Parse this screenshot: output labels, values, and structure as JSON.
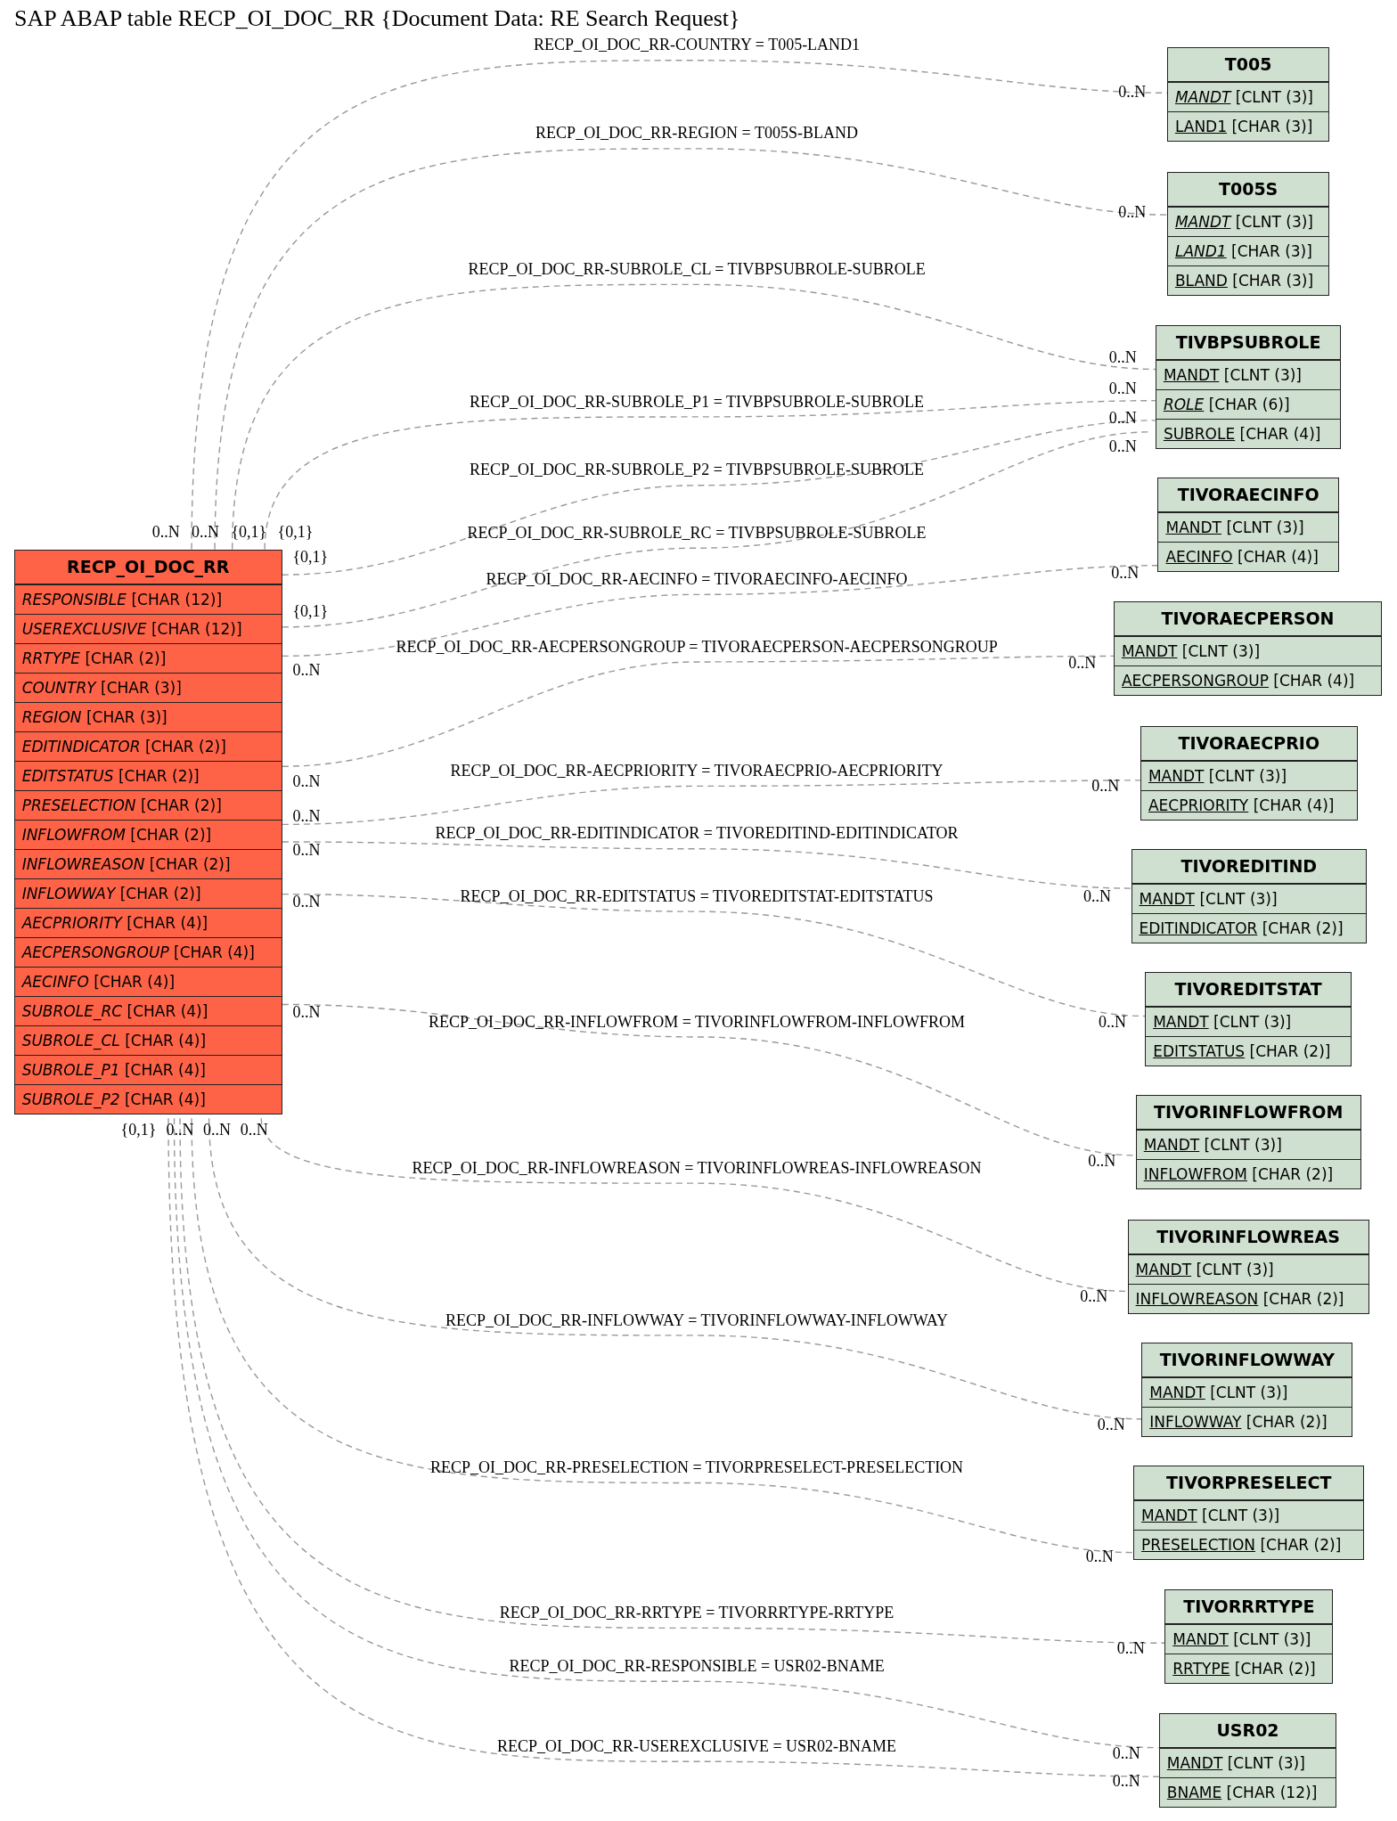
{
  "title": "SAP ABAP table RECP_OI_DOC_RR {Document Data: RE Search Request}",
  "main_table": {
    "name": "RECP_OI_DOC_RR",
    "fields": [
      {
        "name": "RESPONSIBLE",
        "type": "[CHAR (12)]",
        "primary_key": false,
        "foreign_key": true
      },
      {
        "name": "USEREXCLUSIVE",
        "type": "[CHAR (12)]",
        "primary_key": false,
        "foreign_key": true
      },
      {
        "name": "RRTYPE",
        "type": "[CHAR (2)]",
        "primary_key": false,
        "foreign_key": true
      },
      {
        "name": "COUNTRY",
        "type": "[CHAR (3)]",
        "primary_key": false,
        "foreign_key": true
      },
      {
        "name": "REGION",
        "type": "[CHAR (3)]",
        "primary_key": false,
        "foreign_key": true
      },
      {
        "name": "EDITINDICATOR",
        "type": "[CHAR (2)]",
        "primary_key": false,
        "foreign_key": true
      },
      {
        "name": "EDITSTATUS",
        "type": "[CHAR (2)]",
        "primary_key": false,
        "foreign_key": true
      },
      {
        "name": "PRESELECTION",
        "type": "[CHAR (2)]",
        "primary_key": false,
        "foreign_key": true
      },
      {
        "name": "INFLOWFROM",
        "type": "[CHAR (2)]",
        "primary_key": false,
        "foreign_key": true
      },
      {
        "name": "INFLOWREASON",
        "type": "[CHAR (2)]",
        "primary_key": false,
        "foreign_key": true
      },
      {
        "name": "INFLOWWAY",
        "type": "[CHAR (2)]",
        "primary_key": false,
        "foreign_key": true
      },
      {
        "name": "AECPRIORITY",
        "type": "[CHAR (4)]",
        "primary_key": false,
        "foreign_key": true
      },
      {
        "name": "AECPERSONGROUP",
        "type": "[CHAR (4)]",
        "primary_key": false,
        "foreign_key": true
      },
      {
        "name": "AECINFO",
        "type": "[CHAR (4)]",
        "primary_key": false,
        "foreign_key": true
      },
      {
        "name": "SUBROLE_RC",
        "type": "[CHAR (4)]",
        "primary_key": false,
        "foreign_key": true
      },
      {
        "name": "SUBROLE_CL",
        "type": "[CHAR (4)]",
        "primary_key": false,
        "foreign_key": true
      },
      {
        "name": "SUBROLE_P1",
        "type": "[CHAR (4)]",
        "primary_key": false,
        "foreign_key": true
      },
      {
        "name": "SUBROLE_P2",
        "type": "[CHAR (4)]",
        "primary_key": false,
        "foreign_key": true
      }
    ]
  },
  "tables": [
    {
      "name": "T005",
      "fields": [
        {
          "name": "MANDT",
          "type": "[CLNT (3)]",
          "primary_key": true,
          "foreign_key": true
        },
        {
          "name": "LAND1",
          "type": "[CHAR (3)]",
          "primary_key": true,
          "foreign_key": false
        }
      ],
      "relations": [
        {
          "label": "RECP_OI_DOC_RR-COUNTRY = T005-LAND1",
          "source_cardinality": "0..N",
          "target_cardinality": "0..N"
        }
      ]
    },
    {
      "name": "T005S",
      "fields": [
        {
          "name": "MANDT",
          "type": "[CLNT (3)]",
          "primary_key": true,
          "foreign_key": true
        },
        {
          "name": "LAND1",
          "type": "[CHAR (3)]",
          "primary_key": true,
          "foreign_key": true
        },
        {
          "name": "BLAND",
          "type": "[CHAR (3)]",
          "primary_key": true,
          "foreign_key": false
        }
      ],
      "relations": [
        {
          "label": "RECP_OI_DOC_RR-REGION = T005S-BLAND",
          "source_cardinality": "0..N",
          "target_cardinality": "0..N"
        }
      ]
    },
    {
      "name": "TIVBPSUBROLE",
      "fields": [
        {
          "name": "MANDT",
          "type": "[CLNT (3)]",
          "primary_key": true,
          "foreign_key": false
        },
        {
          "name": "ROLE",
          "type": "[CHAR (6)]",
          "primary_key": true,
          "foreign_key": true
        },
        {
          "name": "SUBROLE",
          "type": "[CHAR (4)]",
          "primary_key": true,
          "foreign_key": false
        }
      ],
      "relations": [
        {
          "label": "RECP_OI_DOC_RR-SUBROLE_CL = TIVBPSUBROLE-SUBROLE",
          "source_cardinality": "{0,1}",
          "target_cardinality": "0..N"
        },
        {
          "label": "RECP_OI_DOC_RR-SUBROLE_P1 = TIVBPSUBROLE-SUBROLE",
          "source_cardinality": "{0,1}",
          "target_cardinality": "0..N"
        },
        {
          "label": "RECP_OI_DOC_RR-SUBROLE_P2 = TIVBPSUBROLE-SUBROLE",
          "source_cardinality": "{0,1}",
          "target_cardinality": "0..N"
        },
        {
          "label": "RECP_OI_DOC_RR-SUBROLE_RC = TIVBPSUBROLE-SUBROLE",
          "source_cardinality": "{0,1}",
          "target_cardinality": "0..N"
        }
      ]
    },
    {
      "name": "TIVORAECINFO",
      "fields": [
        {
          "name": "MANDT",
          "type": "[CLNT (3)]",
          "primary_key": true,
          "foreign_key": false
        },
        {
          "name": "AECINFO",
          "type": "[CHAR (4)]",
          "primary_key": true,
          "foreign_key": false
        }
      ],
      "relations": [
        {
          "label": "RECP_OI_DOC_RR-AECINFO = TIVORAECINFO-AECINFO",
          "source_cardinality": "0..N",
          "target_cardinality": "0..N"
        }
      ]
    },
    {
      "name": "TIVORAECPERSON",
      "fields": [
        {
          "name": "MANDT",
          "type": "[CLNT (3)]",
          "primary_key": true,
          "foreign_key": false
        },
        {
          "name": "AECPERSONGROUP",
          "type": "[CHAR (4)]",
          "primary_key": true,
          "foreign_key": false
        }
      ],
      "relations": [
        {
          "label": "RECP_OI_DOC_RR-AECPERSONGROUP = TIVORAECPERSON-AECPERSONGROUP",
          "source_cardinality": "0..N",
          "target_cardinality": "0..N"
        }
      ]
    },
    {
      "name": "TIVORAECPRIO",
      "fields": [
        {
          "name": "MANDT",
          "type": "[CLNT (3)]",
          "primary_key": true,
          "foreign_key": false
        },
        {
          "name": "AECPRIORITY",
          "type": "[CHAR (4)]",
          "primary_key": true,
          "foreign_key": false
        }
      ],
      "relations": [
        {
          "label": "RECP_OI_DOC_RR-AECPRIORITY = TIVORAECPRIO-AECPRIORITY",
          "source_cardinality": "0..N",
          "target_cardinality": "0..N"
        }
      ]
    },
    {
      "name": "TIVOREDITIND",
      "fields": [
        {
          "name": "MANDT",
          "type": "[CLNT (3)]",
          "primary_key": true,
          "foreign_key": false
        },
        {
          "name": "EDITINDICATOR",
          "type": "[CHAR (2)]",
          "primary_key": true,
          "foreign_key": false
        }
      ],
      "relations": [
        {
          "label": "RECP_OI_DOC_RR-EDITINDICATOR = TIVOREDITIND-EDITINDICATOR",
          "source_cardinality": "0..N",
          "target_cardinality": "0..N"
        }
      ]
    },
    {
      "name": "TIVOREDITSTAT",
      "fields": [
        {
          "name": "MANDT",
          "type": "[CLNT (3)]",
          "primary_key": true,
          "foreign_key": false
        },
        {
          "name": "EDITSTATUS",
          "type": "[CHAR (2)]",
          "primary_key": true,
          "foreign_key": false
        }
      ],
      "relations": [
        {
          "label": "RECP_OI_DOC_RR-EDITSTATUS = TIVOREDITSTAT-EDITSTATUS",
          "source_cardinality": "0..N",
          "target_cardinality": "0..N"
        }
      ]
    },
    {
      "name": "TIVORINFLOWFROM",
      "fields": [
        {
          "name": "MANDT",
          "type": "[CLNT (3)]",
          "primary_key": true,
          "foreign_key": false
        },
        {
          "name": "INFLOWFROM",
          "type": "[CHAR (2)]",
          "primary_key": true,
          "foreign_key": false
        }
      ],
      "relations": [
        {
          "label": "RECP_OI_DOC_RR-INFLOWFROM = TIVORINFLOWFROM-INFLOWFROM",
          "source_cardinality": "0..N",
          "target_cardinality": "0..N"
        }
      ]
    },
    {
      "name": "TIVORINFLOWREAS",
      "fields": [
        {
          "name": "MANDT",
          "type": "[CLNT (3)]",
          "primary_key": true,
          "foreign_key": false
        },
        {
          "name": "INFLOWREASON",
          "type": "[CHAR (2)]",
          "primary_key": true,
          "foreign_key": false
        }
      ],
      "relations": [
        {
          "label": "RECP_OI_DOC_RR-INFLOWREASON = TIVORINFLOWREAS-INFLOWREASON",
          "source_cardinality": "0..N",
          "target_cardinality": "0..N"
        }
      ]
    },
    {
      "name": "TIVORINFLOWWAY",
      "fields": [
        {
          "name": "MANDT",
          "type": "[CLNT (3)]",
          "primary_key": true,
          "foreign_key": false
        },
        {
          "name": "INFLOWWAY",
          "type": "[CHAR (2)]",
          "primary_key": true,
          "foreign_key": false
        }
      ],
      "relations": [
        {
          "label": "RECP_OI_DOC_RR-INFLOWWAY = TIVORINFLOWWAY-INFLOWWAY",
          "source_cardinality": "0..N",
          "target_cardinality": "0..N"
        }
      ]
    },
    {
      "name": "TIVORPRESELECT",
      "fields": [
        {
          "name": "MANDT",
          "type": "[CLNT (3)]",
          "primary_key": true,
          "foreign_key": false
        },
        {
          "name": "PRESELECTION",
          "type": "[CHAR (2)]",
          "primary_key": true,
          "foreign_key": false
        }
      ],
      "relations": [
        {
          "label": "RECP_OI_DOC_RR-PRESELECTION = TIVORPRESELECT-PRESELECTION",
          "source_cardinality": "0..N",
          "target_cardinality": "0..N"
        }
      ]
    },
    {
      "name": "TIVORRRTYPE",
      "fields": [
        {
          "name": "MANDT",
          "type": "[CLNT (3)]",
          "primary_key": true,
          "foreign_key": false
        },
        {
          "name": "RRTYPE",
          "type": "[CHAR (2)]",
          "primary_key": true,
          "foreign_key": false
        }
      ],
      "relations": [
        {
          "label": "RECP_OI_DOC_RR-RRTYPE = TIVORRRTYPE-RRTYPE",
          "source_cardinality": "{0,1}",
          "target_cardinality": "0..N"
        }
      ]
    },
    {
      "name": "USR02",
      "fields": [
        {
          "name": "MANDT",
          "type": "[CLNT (3)]",
          "primary_key": true,
          "foreign_key": false
        },
        {
          "name": "BNAME",
          "type": "[CHAR (12)]",
          "primary_key": true,
          "foreign_key": false
        }
      ],
      "relations": [
        {
          "label": "RECP_OI_DOC_RR-RESPONSIBLE = USR02-BNAME",
          "target_cardinality": "0..N"
        },
        {
          "label": "RECP_OI_DOC_RR-USEREXCLUSIVE = USR02-BNAME",
          "target_cardinality": "0..N"
        }
      ]
    }
  ]
}
